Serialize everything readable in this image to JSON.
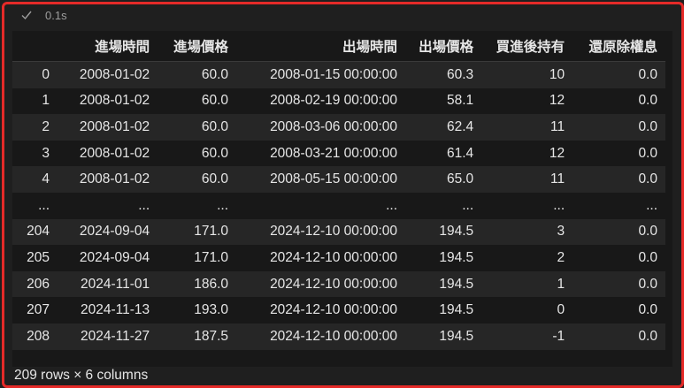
{
  "cell": {
    "status_icon": "check-icon",
    "exec_time": "0.1s"
  },
  "table": {
    "columns": [
      "",
      "進場時間",
      "進場價格",
      "出場時間",
      "出場價格",
      "買進後持有",
      "還原除權息"
    ],
    "rows": [
      [
        "0",
        "2008-01-02",
        "60.0",
        "2008-01-15 00:00:00",
        "60.3",
        "10",
        "0.0"
      ],
      [
        "1",
        "2008-01-02",
        "60.0",
        "2008-02-19 00:00:00",
        "58.1",
        "12",
        "0.0"
      ],
      [
        "2",
        "2008-01-02",
        "60.0",
        "2008-03-06 00:00:00",
        "62.4",
        "11",
        "0.0"
      ],
      [
        "3",
        "2008-01-02",
        "60.0",
        "2008-03-21 00:00:00",
        "61.4",
        "12",
        "0.0"
      ],
      [
        "4",
        "2008-01-02",
        "60.0",
        "2008-05-15 00:00:00",
        "65.0",
        "11",
        "0.0"
      ],
      [
        "...",
        "...",
        "...",
        "...",
        "...",
        "...",
        "..."
      ],
      [
        "204",
        "2024-09-04",
        "171.0",
        "2024-12-10 00:00:00",
        "194.5",
        "3",
        "0.0"
      ],
      [
        "205",
        "2024-09-04",
        "171.0",
        "2024-12-10 00:00:00",
        "194.5",
        "2",
        "0.0"
      ],
      [
        "206",
        "2024-11-01",
        "186.0",
        "2024-12-10 00:00:00",
        "194.5",
        "1",
        "0.0"
      ],
      [
        "207",
        "2024-11-13",
        "193.0",
        "2024-12-10 00:00:00",
        "194.5",
        "0",
        "0.0"
      ],
      [
        "208",
        "2024-11-27",
        "187.5",
        "2024-12-10 00:00:00",
        "194.5",
        "-1",
        "0.0"
      ]
    ]
  },
  "footer": {
    "summary": "209 rows × 6 columns"
  },
  "colors": {
    "highlight_border": "#e52a28",
    "background": "#1f1f1f",
    "row_stripe": "#262626",
    "text": "#e6e6e6"
  }
}
